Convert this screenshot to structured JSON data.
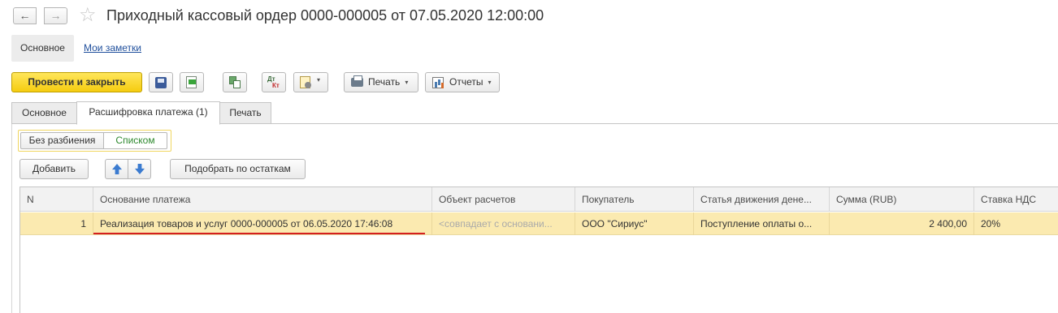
{
  "header": {
    "back_icon": "←",
    "forward_icon": "→",
    "star_icon": "☆",
    "title": "Приходный кассовый ордер 0000-000005 от 07.05.2020 12:00:00"
  },
  "section_tabs": {
    "active": "Основное",
    "link": "Мои заметки"
  },
  "toolbar": {
    "post_and_close": "Провести и закрыть",
    "print_label": "Печать",
    "reports_label": "Отчеты",
    "dt_label": "Дт",
    "kt_label": "Кт",
    "caret": "▾"
  },
  "tabs": [
    "Основное",
    "Расшифровка платежа (1)",
    "Печать"
  ],
  "mode": {
    "option1": "Без разбиения",
    "option2": "Списком"
  },
  "list_toolbar": {
    "add": "Добавить",
    "pick": "Подобрать по остаткам"
  },
  "table": {
    "columns": [
      "N",
      "Основание платежа",
      "Объект расчетов",
      "Покупатель",
      "Статья движения дене...",
      "Сумма (RUB)",
      "Ставка НДС"
    ],
    "rows": [
      {
        "n": "1",
        "basis": "Реализация товаров и услуг 0000-000005 от 06.05.2020 17:46:08",
        "object": "<совпадает с основани...",
        "buyer": "ООО \"Сириус\"",
        "item": "Поступление оплаты о...",
        "sum": "2 400,00",
        "vat": "20%"
      }
    ]
  },
  "colors": {
    "primary_button": "#f5cc10",
    "selected_row": "#fbeab0",
    "highlight_underline": "#d42020",
    "link": "#1f4f9c",
    "mode_active_text": "#2f8a2f"
  }
}
